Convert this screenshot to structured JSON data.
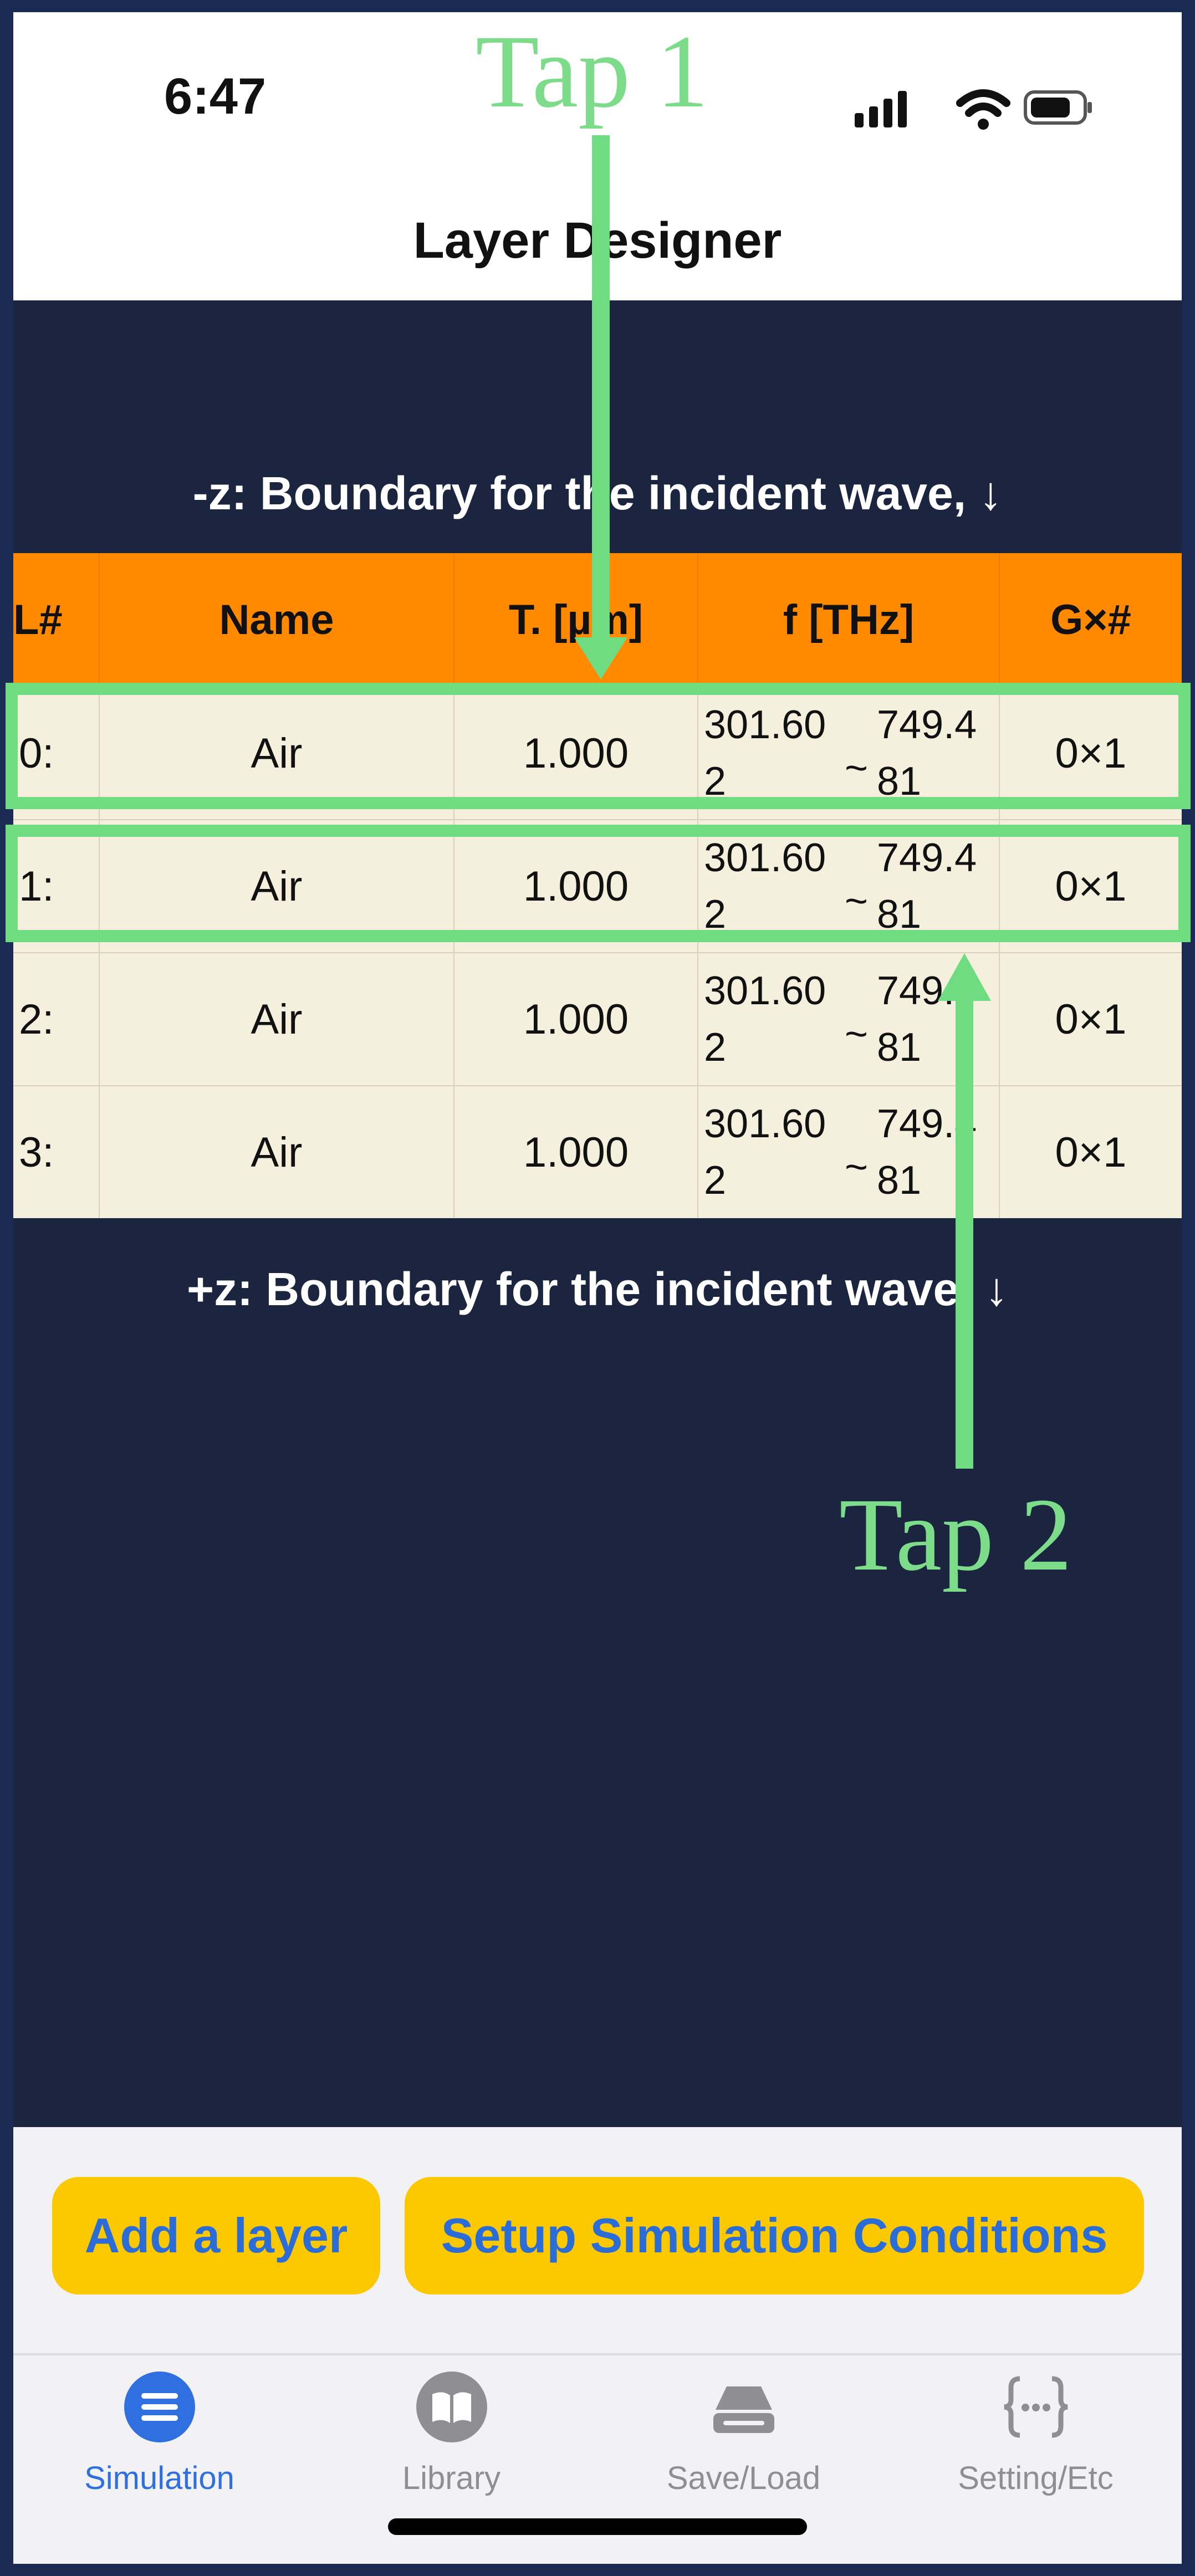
{
  "status_bar": {
    "time": "6:47"
  },
  "nav": {
    "title": "Layer Designer"
  },
  "boundary_top": "-z: Boundary for the incident wave, ↓",
  "boundary_bottom": "+z: Boundary for the incident wave, ↓",
  "table": {
    "headers": [
      "L#",
      "Name",
      "T. [µm]",
      "f [THz]",
      "G×#"
    ],
    "rows": [
      {
        "index": "0:",
        "name": "Air",
        "thickness": "1.000",
        "f_min_1": "301.60",
        "f_min_2": "2",
        "f_max_1": "749.4",
        "f_max_2": "81",
        "grid": "0×1"
      },
      {
        "index": "1:",
        "name": "Air",
        "thickness": "1.000",
        "f_min_1": "301.60",
        "f_min_2": "2",
        "f_max_1": "749.4",
        "f_max_2": "81",
        "grid": "0×1"
      },
      {
        "index": "2:",
        "name": "Air",
        "thickness": "1.000",
        "f_min_1": "301.60",
        "f_min_2": "2",
        "f_max_1": "749.4",
        "f_max_2": "81",
        "grid": "0×1"
      },
      {
        "index": "3:",
        "name": "Air",
        "thickness": "1.000",
        "f_min_1": "301.60",
        "f_min_2": "2",
        "f_max_1": "749.4",
        "f_max_2": "81",
        "grid": "0×1"
      }
    ],
    "range_separator": "~"
  },
  "annotations": {
    "tap1": "Tap 1",
    "tap2": "Tap 2"
  },
  "buttons": {
    "add_layer": "Add a layer",
    "setup": "Setup Simulation Conditions"
  },
  "tabs": [
    {
      "label": "Simulation",
      "icon": "list-icon",
      "active": true
    },
    {
      "label": "Library",
      "icon": "book-icon",
      "active": false
    },
    {
      "label": "Save/Load",
      "icon": "drive-icon",
      "active": false
    },
    {
      "label": "Setting/Etc",
      "icon": "braces-icon",
      "active": false
    }
  ],
  "colors": {
    "header_row": "#ff8a00",
    "row_bg": "#f4f0dd",
    "background": "#1b2540",
    "button": "#fcc800",
    "button_text": "#2a6cd8",
    "annotation": "#6fdc82",
    "tab_active": "#2f6fe0"
  }
}
